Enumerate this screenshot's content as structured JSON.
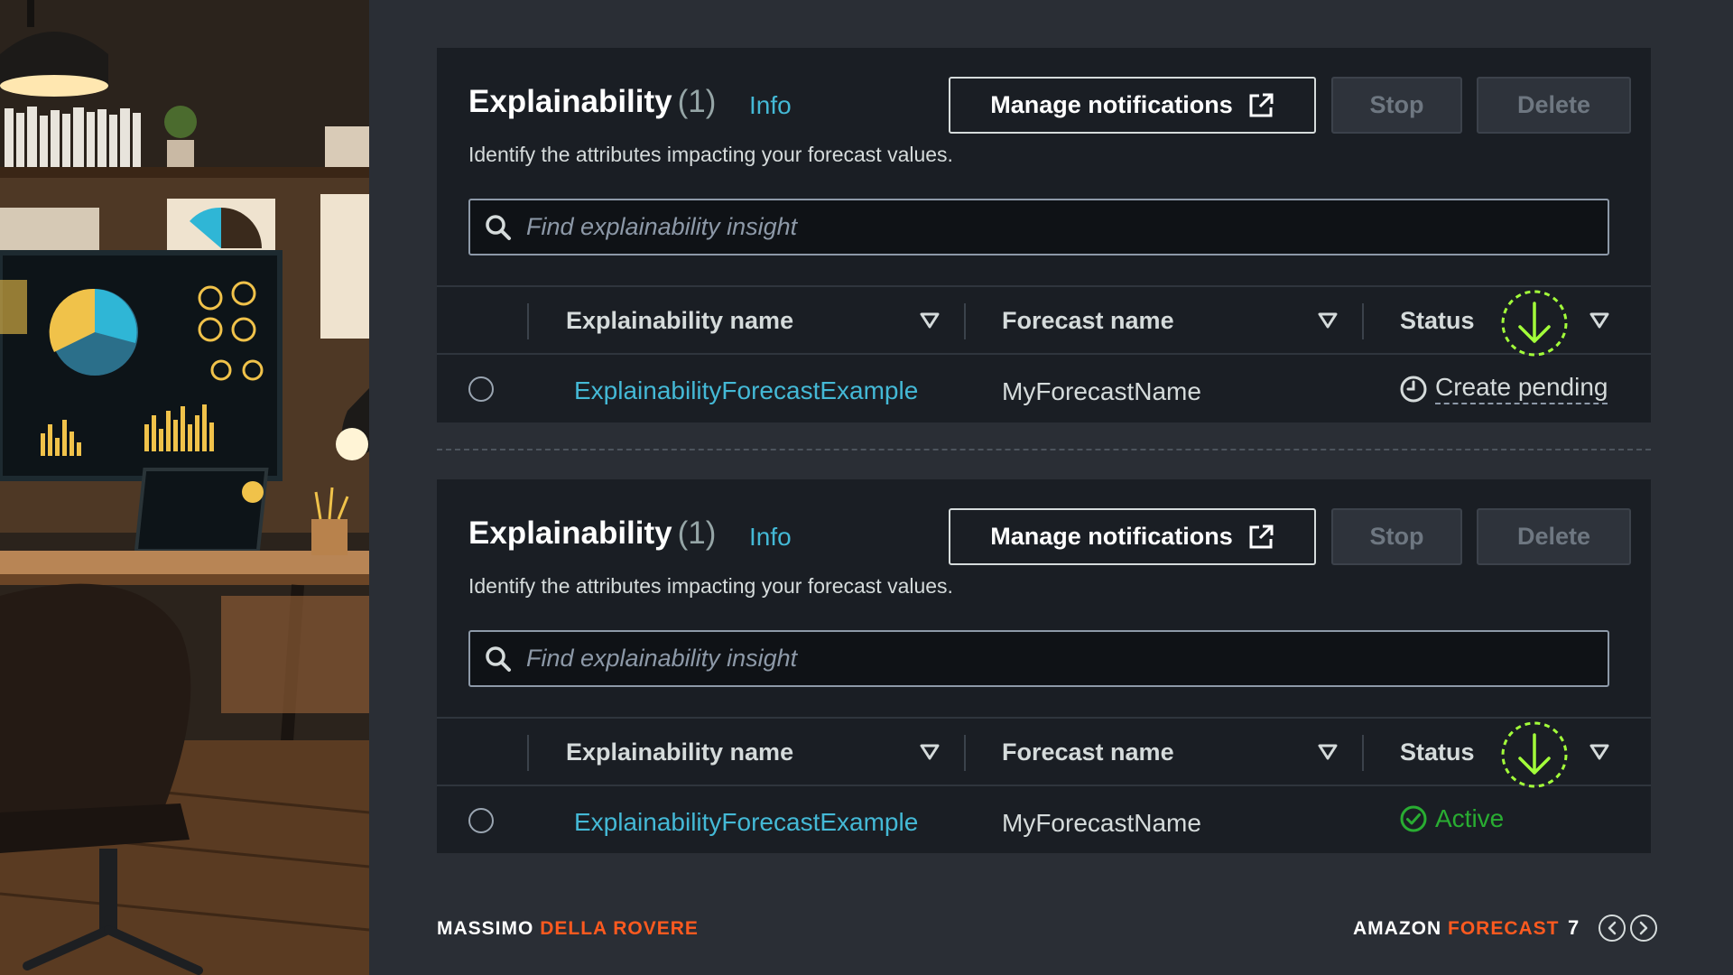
{
  "colors": {
    "background": "#2a2e35",
    "panel": "#1a1e24",
    "link": "#44b9d6",
    "accent": "#ff5a1f",
    "active_status": "#29ad32",
    "highlight_ring": "#a3ff3a"
  },
  "panels": [
    {
      "title": "Explainability",
      "count": "(1)",
      "info": "Info",
      "buttons": {
        "manage": "Manage notifications",
        "stop": "Stop",
        "delete": "Delete"
      },
      "description": "Identify the attributes impacting your forecast values.",
      "search_placeholder": "Find explainability insight",
      "columns": {
        "name": "Explainability name",
        "forecast": "Forecast name",
        "status": "Status"
      },
      "row": {
        "name": "ExplainabilityForecastExample",
        "forecast": "MyForecastName",
        "status": "Create pending",
        "status_icon": "clock-icon"
      }
    },
    {
      "title": "Explainability",
      "count": "(1)",
      "info": "Info",
      "buttons": {
        "manage": "Manage notifications",
        "stop": "Stop",
        "delete": "Delete"
      },
      "description": "Identify the attributes impacting your forecast values.",
      "search_placeholder": "Find explainability insight",
      "columns": {
        "name": "Explainability name",
        "forecast": "Forecast name",
        "status": "Status"
      },
      "row": {
        "name": "ExplainabilityForecastExample",
        "forecast": "MyForecastName",
        "status": "Active",
        "status_icon": "check-circle-icon"
      }
    }
  ],
  "footer": {
    "author_first": "MASSIMO",
    "author_last": "DELLA ROVERE",
    "product_first": "AMAZON",
    "product_last": "FORECAST",
    "page": "7"
  }
}
